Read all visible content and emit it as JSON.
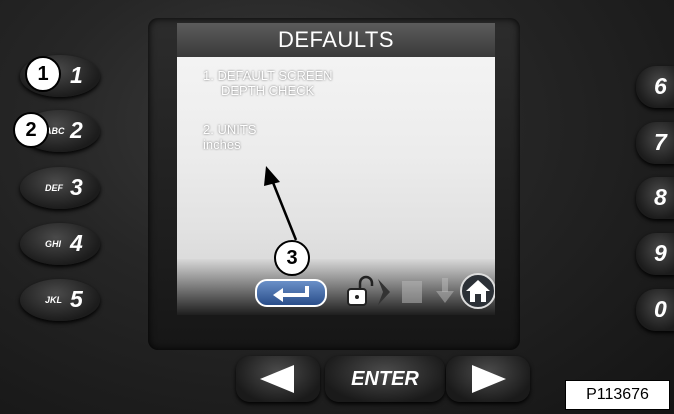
{
  "screen": {
    "title": "DEFAULTS",
    "item1_line1": "1. DEFAULT SCREEN",
    "item1_line2": "DEPTH CHECK",
    "item2_line1": "2. UNITS",
    "item2_value": "inches",
    "bottom_icons": [
      "return-icon",
      "unlock-icon",
      "chevron-right-icon",
      "page-icon",
      "down-arrow-icon",
      "home-icon"
    ]
  },
  "keypad_left": [
    {
      "letters": "#",
      "digit": "1"
    },
    {
      "letters": "ABC",
      "digit": "2"
    },
    {
      "letters": "DEF",
      "digit": "3"
    },
    {
      "letters": "GHI",
      "digit": "4"
    },
    {
      "letters": "JKL",
      "digit": "5"
    }
  ],
  "keypad_right": [
    {
      "digit": "6"
    },
    {
      "digit": "7"
    },
    {
      "digit": "8"
    },
    {
      "digit": "9"
    },
    {
      "digit": "0"
    }
  ],
  "nav": {
    "left_icon": "triangle-left-icon",
    "enter_label": "ENTER",
    "right_icon": "triangle-right-icon"
  },
  "callouts": [
    "1",
    "2",
    "3"
  ],
  "part_number": "P113676",
  "colors": {
    "screen_title_bg": "#444444",
    "screen_bg": "#eeeeee",
    "body": "#222222"
  }
}
